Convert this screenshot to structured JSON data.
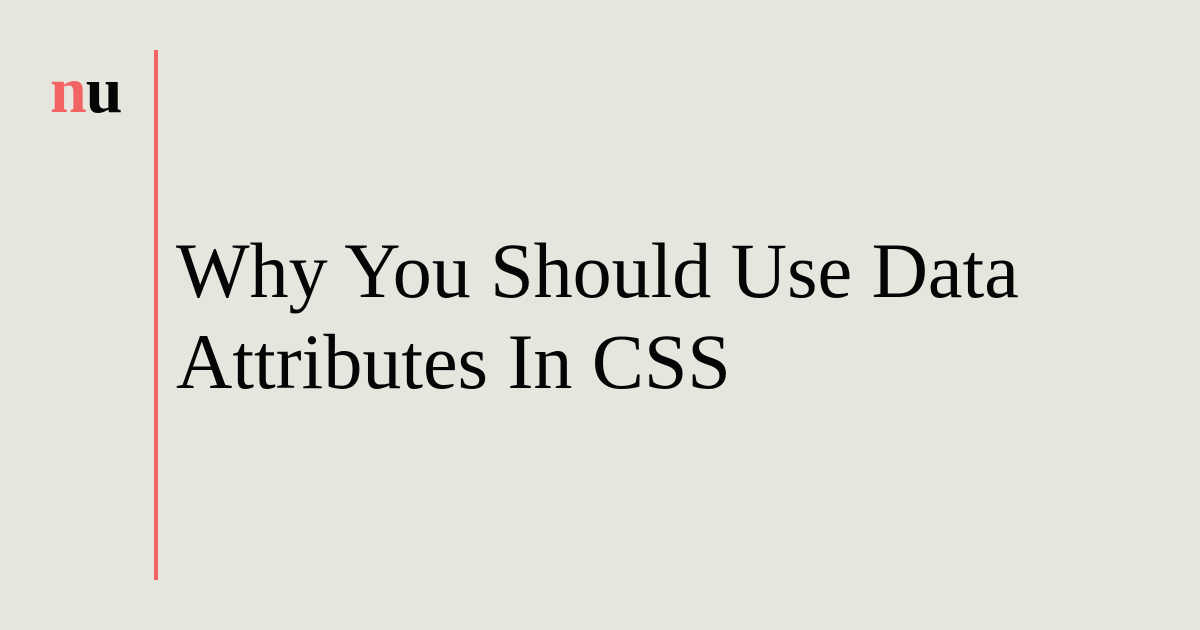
{
  "logo": {
    "part_accent": "n",
    "part_dark": "u",
    "accent_color": "#f26464",
    "dark_color": "#050505"
  },
  "title": {
    "line1": "Why You Should Use Data",
    "line2": "Attributes In CSS"
  },
  "colors": {
    "background": "#e6e5de",
    "accent": "#f26464",
    "text": "#050505"
  }
}
